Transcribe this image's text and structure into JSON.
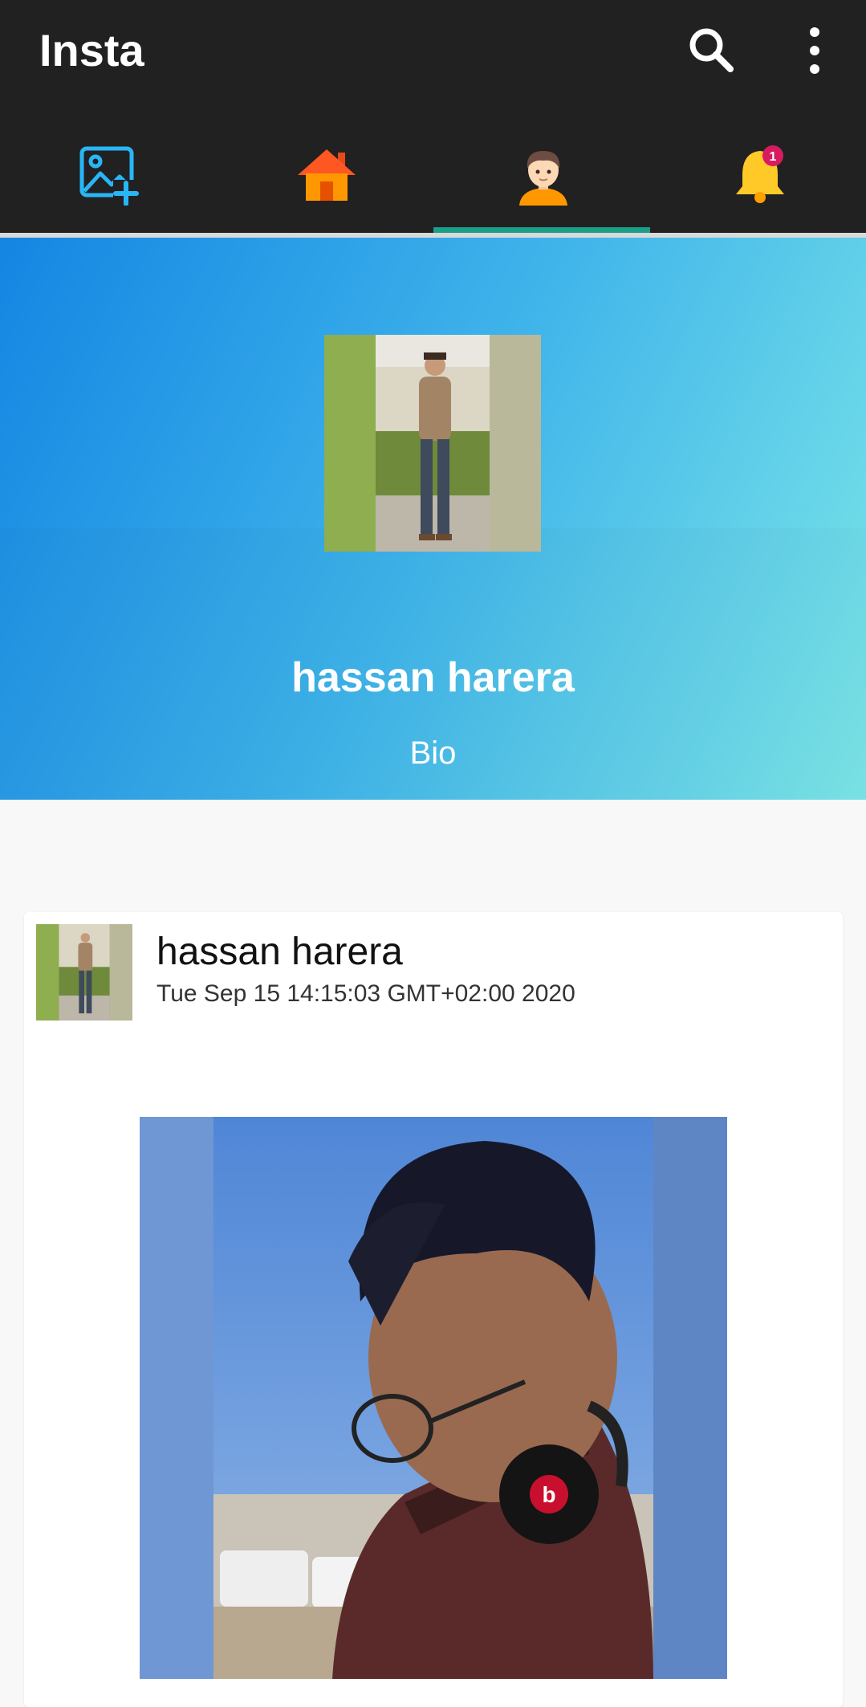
{
  "app": {
    "title": "Insta"
  },
  "toolbar": {
    "search_icon": "search-icon",
    "more_icon": "more-vert-icon"
  },
  "tabs": [
    {
      "name": "add-photo",
      "icon": "image-plus-icon"
    },
    {
      "name": "home",
      "icon": "home-icon"
    },
    {
      "name": "profile",
      "icon": "user-avatar-icon",
      "selected": true
    },
    {
      "name": "notifications",
      "icon": "bell-icon",
      "badge": "1"
    }
  ],
  "profile": {
    "name": "hassan harera",
    "bio": "Bio"
  },
  "post": {
    "author": "hassan harera",
    "timestamp": "Tue Sep 15 14:15:03 GMT+02:00 2020"
  },
  "colors": {
    "appbar": "#212121",
    "tab_indicator": "#1aa088",
    "header_gradient_start": "#1486e3",
    "header_gradient_end": "#7ce6e8",
    "badge": "#d81b60"
  }
}
